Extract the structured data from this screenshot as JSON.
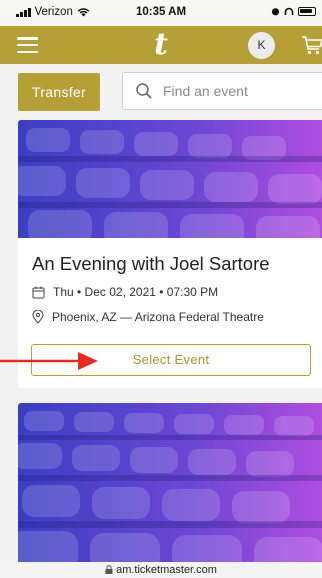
{
  "status_bar": {
    "carrier": "Verizon",
    "time": "10:35 AM"
  },
  "header": {
    "logo_text": "t",
    "avatar_initial": "K",
    "menu_icon": "hamburger-icon",
    "cart_icon": "cart-icon",
    "background": "#b5a036"
  },
  "actions": {
    "transfer_label": "Transfer",
    "search_placeholder": "Find an event"
  },
  "events": [
    {
      "title": "An Evening with Joel Sartore",
      "date": "Thu • Dec 02, 2021 • 07:30 PM",
      "venue": "Phoenix, AZ — Arizona Federal Theatre",
      "select_label": "Select Event"
    }
  ],
  "annotation": {
    "arrow_color": "#e8291c"
  },
  "browser": {
    "url": "am.ticketmaster.com"
  }
}
